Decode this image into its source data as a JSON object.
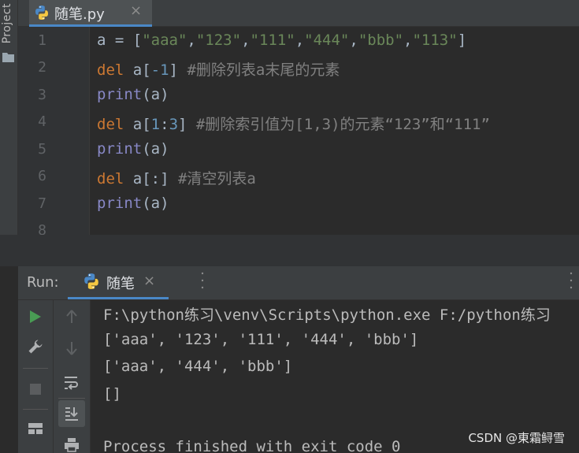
{
  "sidebar": {
    "project_label": "Project"
  },
  "editor_tab": {
    "title": "随笔.py",
    "close_glyph": "×"
  },
  "editor": {
    "line_numbers": [
      "1",
      "2",
      "3",
      "4",
      "5",
      "6",
      "7",
      "8"
    ],
    "lines": [
      [
        {
          "t": "a = [",
          "c": "plain"
        },
        {
          "t": "\"aaa\"",
          "c": "str"
        },
        {
          "t": ",",
          "c": "plain"
        },
        {
          "t": "\"123\"",
          "c": "str"
        },
        {
          "t": ",",
          "c": "plain"
        },
        {
          "t": "\"111\"",
          "c": "str"
        },
        {
          "t": ",",
          "c": "plain"
        },
        {
          "t": "\"444\"",
          "c": "str"
        },
        {
          "t": ",",
          "c": "plain"
        },
        {
          "t": "\"bbb\"",
          "c": "str"
        },
        {
          "t": ",",
          "c": "plain"
        },
        {
          "t": "\"113\"",
          "c": "str"
        },
        {
          "t": "]",
          "c": "plain"
        }
      ],
      [
        {
          "t": "del",
          "c": "kw"
        },
        {
          "t": " a[",
          "c": "plain"
        },
        {
          "t": "-1",
          "c": "num"
        },
        {
          "t": "] ",
          "c": "plain"
        },
        {
          "t": "#删除列表a末尾的元素",
          "c": "cmt"
        }
      ],
      [
        {
          "t": "print",
          "c": "bi"
        },
        {
          "t": "(a)",
          "c": "plain"
        }
      ],
      [
        {
          "t": "del",
          "c": "kw"
        },
        {
          "t": " a[",
          "c": "plain"
        },
        {
          "t": "1",
          "c": "num"
        },
        {
          "t": ":",
          "c": "plain"
        },
        {
          "t": "3",
          "c": "num"
        },
        {
          "t": "] ",
          "c": "plain"
        },
        {
          "t": "#删除索引值为[1,3)的元素“123”和“111”",
          "c": "cmt"
        }
      ],
      [
        {
          "t": "print",
          "c": "bi"
        },
        {
          "t": "(a)",
          "c": "plain"
        }
      ],
      [
        {
          "t": "del",
          "c": "kw"
        },
        {
          "t": " a[:] ",
          "c": "plain"
        },
        {
          "t": "#清空列表a",
          "c": "cmt"
        }
      ],
      [
        {
          "t": "print",
          "c": "bi"
        },
        {
          "t": "(a)",
          "c": "plain"
        }
      ]
    ]
  },
  "run_panel": {
    "label": "Run:",
    "tab_title": "随笔",
    "close_glyph": "×",
    "toolbar_left": [
      {
        "icon": "run-icon"
      },
      {
        "icon": "wrench-icon"
      },
      {
        "icon": "stop-icon"
      },
      {
        "icon": "layout-icon"
      }
    ],
    "toolbar_right": [
      {
        "icon": "up-arrow-icon"
      },
      {
        "icon": "down-arrow-icon"
      },
      {
        "icon": "soft-wrap-icon"
      },
      {
        "icon": "scroll-to-end-icon"
      },
      {
        "icon": "print-icon"
      }
    ]
  },
  "console": {
    "lines": [
      "F:\\python练习\\venv\\Scripts\\python.exe F:/python练习",
      "['aaa', '123', '111', '444', 'bbb']",
      "['aaa', '444', 'bbb']",
      "[]",
      "",
      "Process finished with exit code 0"
    ]
  },
  "watermark": "CSDN @東霜鲟雪",
  "colors": {
    "string": "#6a8759",
    "keyword": "#cc7832",
    "builtin": "#8888c6",
    "number": "#6897bb",
    "comment": "#808080",
    "text": "#a9b7c6",
    "accent": "#4a88c7",
    "run_green": "#499c54"
  }
}
